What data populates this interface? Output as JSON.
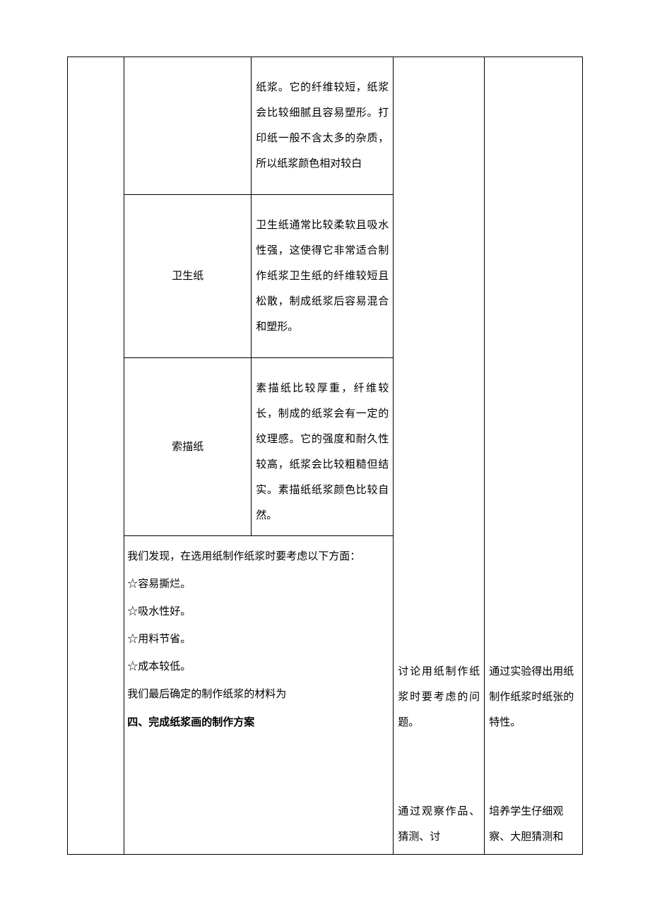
{
  "innerTable": {
    "row1": {
      "name": "",
      "desc": "纸浆。它的纤维较短，纸浆会比较细腻且容易塑形。打印纸一般不含太多的杂质，所以纸浆颜色相对较白"
    },
    "row2": {
      "name": "卫生纸",
      "desc": "卫生纸通常比较柔软且吸水性强，这使得它非常适合制作纸浆卫生纸的纤维较短且松散，制成纸浆后容易混合和塑形。"
    },
    "row3": {
      "name": "索描纸",
      "desc": "素描纸比较厚重，纤维较长，制成的纸浆会有一定的纹理感。它的强度和耐久性较高，纸浆会比较粗糙但结实。素描纸纸浆颜色比较自然。"
    }
  },
  "below": {
    "intro": "我们发现，在选用纸制作纸浆时要考虑以下方面：",
    "b1": "☆容易撕烂。",
    "b2": "☆吸水性好。",
    "b3": "☆用料节省。",
    "b4": "☆成本较低。",
    "final": "我们最后确定的制作纸浆的材料为",
    "section4": "四、完成纸浆画的制作方案"
  },
  "colR1": {
    "block1a": "讨论用纸制作纸浆时要考虑的问题。",
    "block2a": "通过观察作品、猜测、讨"
  },
  "colR2": {
    "block1": "通过实验得出用纸制作纸浆时纸张的特性。",
    "block2": "培养学生仔细观察、大胆猜测和"
  }
}
